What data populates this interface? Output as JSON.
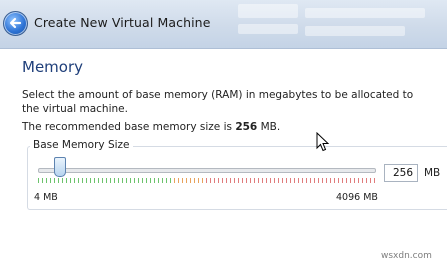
{
  "window": {
    "title": "Create New Virtual Machine"
  },
  "page": {
    "heading": "Memory",
    "description": "Select the amount of base memory (RAM) in megabytes to be allocated to the virtual machine.",
    "recommendation_prefix": "The recommended base memory size is ",
    "recommendation_value": "256",
    "recommendation_suffix": " MB."
  },
  "memory": {
    "group_label": "Base Memory Size",
    "value": "256",
    "unit": "MB",
    "min_label": "4 MB",
    "max_label": "4096 MB",
    "slider_min_mb": 4,
    "slider_max_mb": 4096,
    "slider_value_mb": 256,
    "scale_colors": {
      "safe": "#6cc36c",
      "warning": "#e8a25c",
      "danger": "#e07c7c"
    }
  },
  "watermark": {
    "text": "wsxdn.com"
  },
  "icons": {
    "back": "back-arrow-icon",
    "cursor": "mouse-cursor-icon"
  }
}
